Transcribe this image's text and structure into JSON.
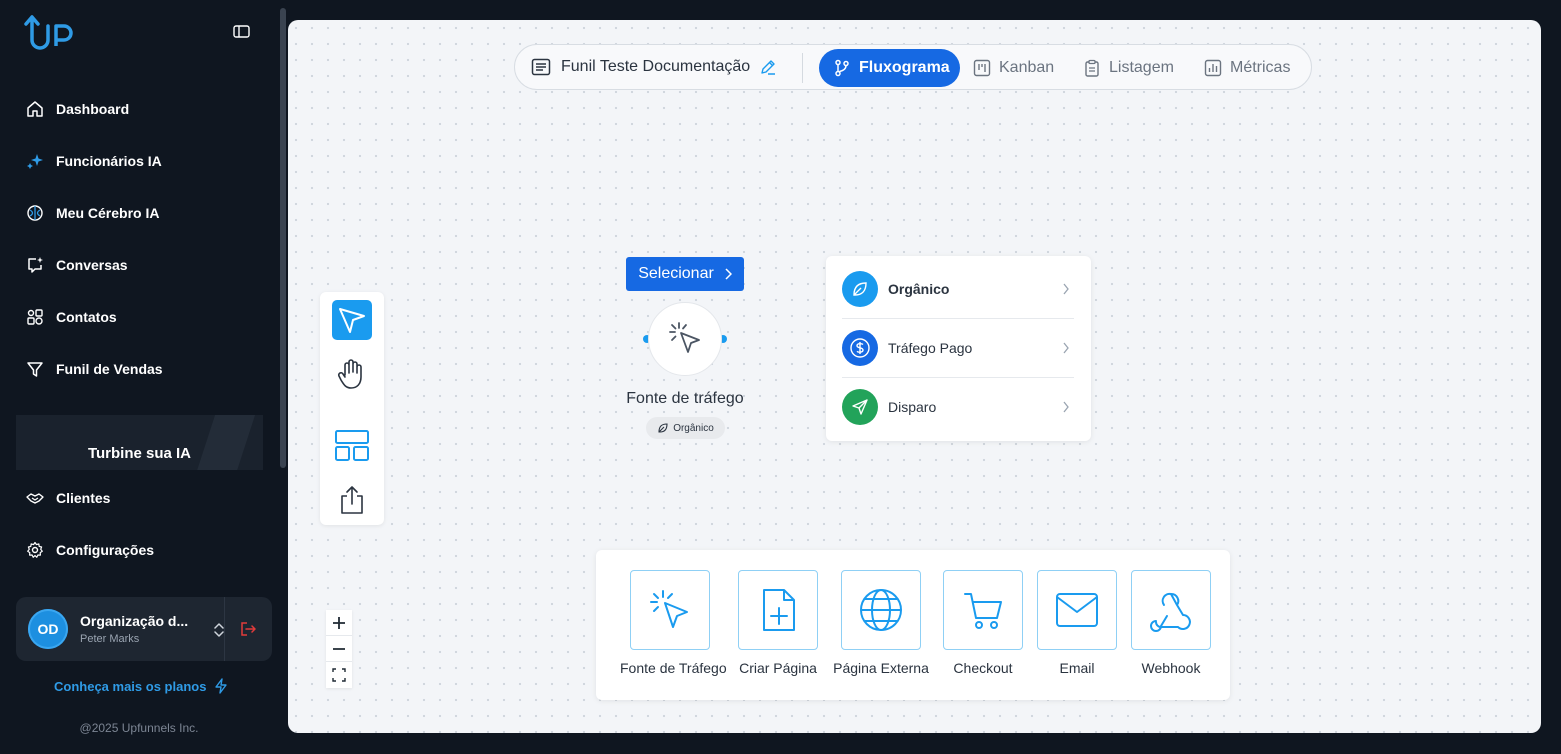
{
  "sidebar": {
    "brand": "UP",
    "nav": [
      {
        "label": "Dashboard",
        "icon": "home-icon"
      },
      {
        "label": "Funcionários IA",
        "icon": "sparkles-icon"
      },
      {
        "label": "Meu Cérebro IA",
        "icon": "brain-icon"
      },
      {
        "label": "Conversas",
        "icon": "chat-icon"
      },
      {
        "label": "Contatos",
        "icon": "contacts-icon"
      },
      {
        "label": "Funil de Vendas",
        "icon": "funnel-icon"
      },
      {
        "label": "Clientes",
        "icon": "handshake-icon"
      },
      {
        "label": "Configurações",
        "icon": "gear-icon"
      }
    ],
    "promo": "Turbine sua IA",
    "org": {
      "initials": "OD",
      "name": "Organização d...",
      "user": "Peter Marks"
    },
    "plans_link": "Conheça mais os planos",
    "copyright": "@2025 Upfunnels Inc."
  },
  "topbar": {
    "funnel_name": "Funil Teste Documentação",
    "tabs": [
      {
        "label": "Fluxograma",
        "active": true
      },
      {
        "label": "Kanban",
        "active": false
      },
      {
        "label": "Listagem",
        "active": false
      },
      {
        "label": "Métricas",
        "active": false
      }
    ]
  },
  "node": {
    "select_label": "Selecionar",
    "label": "Fonte de tráfego",
    "badge": "Orgânico"
  },
  "options": [
    {
      "label": "Orgânico",
      "icon": "leaf-icon",
      "color": "#1a9bef"
    },
    {
      "label": "Tráfego Pago",
      "icon": "dollar-icon",
      "color": "#1669e3"
    },
    {
      "label": "Disparo",
      "icon": "send-icon",
      "color": "#22a35a"
    }
  ],
  "palette": [
    {
      "label": "Fonte de Tráfego",
      "icon": "cursor-click-icon"
    },
    {
      "label": "Criar Página",
      "icon": "file-plus-icon"
    },
    {
      "label": "Página Externa",
      "icon": "globe-icon"
    },
    {
      "label": "Checkout",
      "icon": "cart-icon"
    },
    {
      "label": "Email",
      "icon": "mail-icon"
    },
    {
      "label": "Webhook",
      "icon": "webhook-icon"
    }
  ],
  "colors": {
    "accent": "#1669e3",
    "accent_light": "#1a9bef",
    "sidebar_bg": "#0f1620",
    "logout": "#e23b3b"
  }
}
